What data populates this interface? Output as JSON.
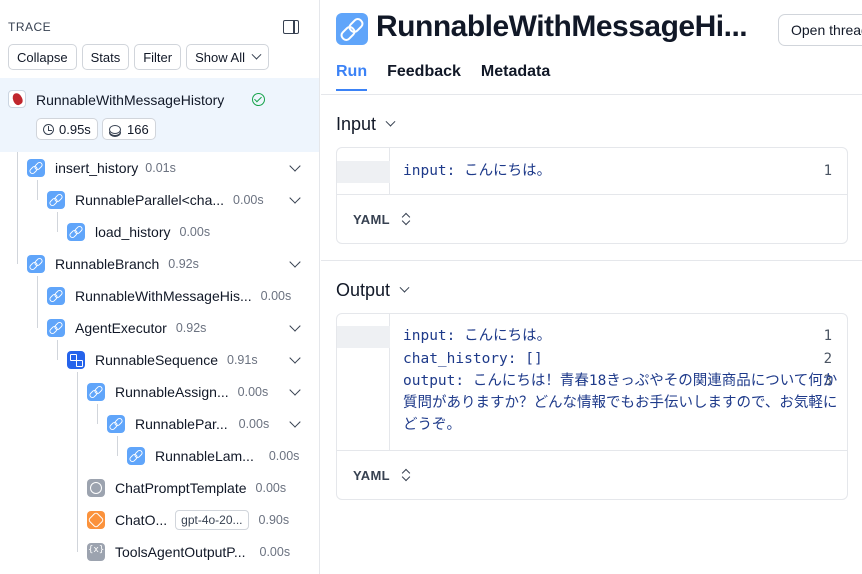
{
  "trace": {
    "header": "TRACE",
    "toolbar": {
      "collapse": "Collapse",
      "stats": "Stats",
      "filter": "Filter",
      "show_all": "Show All"
    },
    "root": {
      "name": "RunnableWithMessageHistory",
      "latency": "0.95s",
      "tokens": "166"
    },
    "nodes": [
      {
        "name": "insert_history",
        "time": "0.01s",
        "icon": "link-icon"
      },
      {
        "name": "RunnableParallel<cha...",
        "time": "0.00s",
        "icon": "link-icon"
      },
      {
        "name": "load_history",
        "time": "0.00s",
        "icon": "link-icon"
      },
      {
        "name": "RunnableBranch",
        "time": "0.92s",
        "icon": "link-icon"
      },
      {
        "name": "RunnableWithMessageHis...",
        "time": "0.00s",
        "icon": "link-icon"
      },
      {
        "name": "AgentExecutor",
        "time": "0.92s",
        "icon": "link-icon"
      },
      {
        "name": "RunnableSequence",
        "time": "0.91s",
        "icon": "sequence-icon"
      },
      {
        "name": "RunnableAssign...",
        "time": "0.00s",
        "icon": "link-icon"
      },
      {
        "name": "RunnablePar...",
        "time": "0.00s",
        "icon": "link-icon"
      },
      {
        "name": "RunnableLam...",
        "time": "0.00s",
        "icon": "link-icon"
      },
      {
        "name": "ChatPromptTemplate",
        "time": "0.00s",
        "icon": "prompt-icon"
      },
      {
        "name": "ChatO...",
        "model": "gpt-4o-20...",
        "time": "0.90s",
        "icon": "openai-icon"
      },
      {
        "name": "ToolsAgentOutputP...",
        "time": "0.00s",
        "icon": "parser-icon"
      }
    ]
  },
  "detail": {
    "title": "RunnableWithMessageHi...",
    "open_thread": "Open thread",
    "tabs": [
      "Run",
      "Feedback",
      "Metadata"
    ],
    "input": {
      "title": "Input",
      "lines": [
        {
          "num": "1",
          "key": "input:",
          "value": "こんにちは。"
        }
      ],
      "format": "YAML"
    },
    "output": {
      "title": "Output",
      "lines": [
        {
          "num": "1",
          "key": "input:",
          "value": "こんにちは。"
        },
        {
          "num": "2",
          "key": "chat_history:",
          "value": "[]"
        },
        {
          "num": "3",
          "key": "output:",
          "value": "こんにちは！青春18きっぷやその関連商品について何か質問がありますか？どんな情報でもお手伝いしますので、お気軽にどうぞ。"
        }
      ],
      "format": "YAML"
    }
  },
  "colors": {
    "accent": "#3b82f6",
    "selected_bg": "#eef5fd",
    "link_icon": "#60a5fa",
    "success": "#16a34a"
  }
}
